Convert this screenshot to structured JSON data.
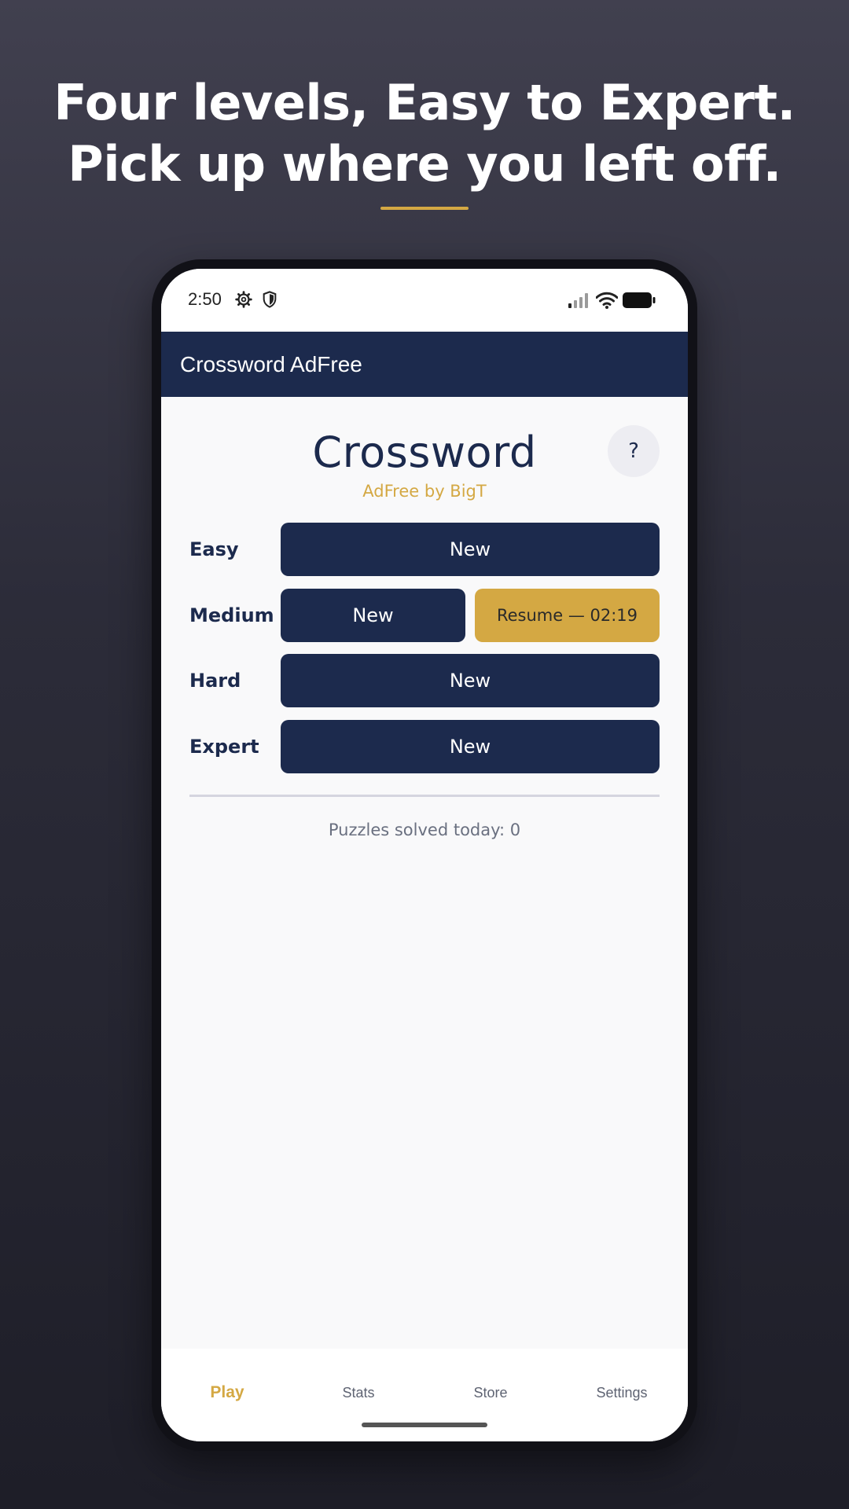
{
  "headline": {
    "line1": "Four levels, Easy to Expert.",
    "line2": "Pick up where you left off.",
    "accent_color": "#d4a843"
  },
  "status_bar": {
    "time": "2:50",
    "icons": [
      "gear-icon",
      "shield-icon",
      "signal-icon",
      "wifi-icon",
      "battery-icon"
    ]
  },
  "app_bar": {
    "title": "Crossword AdFree",
    "color": "#1c2a4d"
  },
  "header": {
    "title": "Crossword",
    "subtitle": "AdFree by BigT",
    "help_label": "?"
  },
  "levels": [
    {
      "label": "Easy",
      "new_label": "New"
    },
    {
      "label": "Medium",
      "new_label": "New",
      "resume_label": "Resume — 02:19"
    },
    {
      "label": "Hard",
      "new_label": "New"
    },
    {
      "label": "Expert",
      "new_label": "New"
    }
  ],
  "stats": {
    "solved_today": "Puzzles solved today: 0"
  },
  "nav": {
    "items": [
      {
        "label": "Play",
        "active": true
      },
      {
        "label": "Stats",
        "active": false
      },
      {
        "label": "Store",
        "active": false
      },
      {
        "label": "Settings",
        "active": false
      }
    ]
  }
}
